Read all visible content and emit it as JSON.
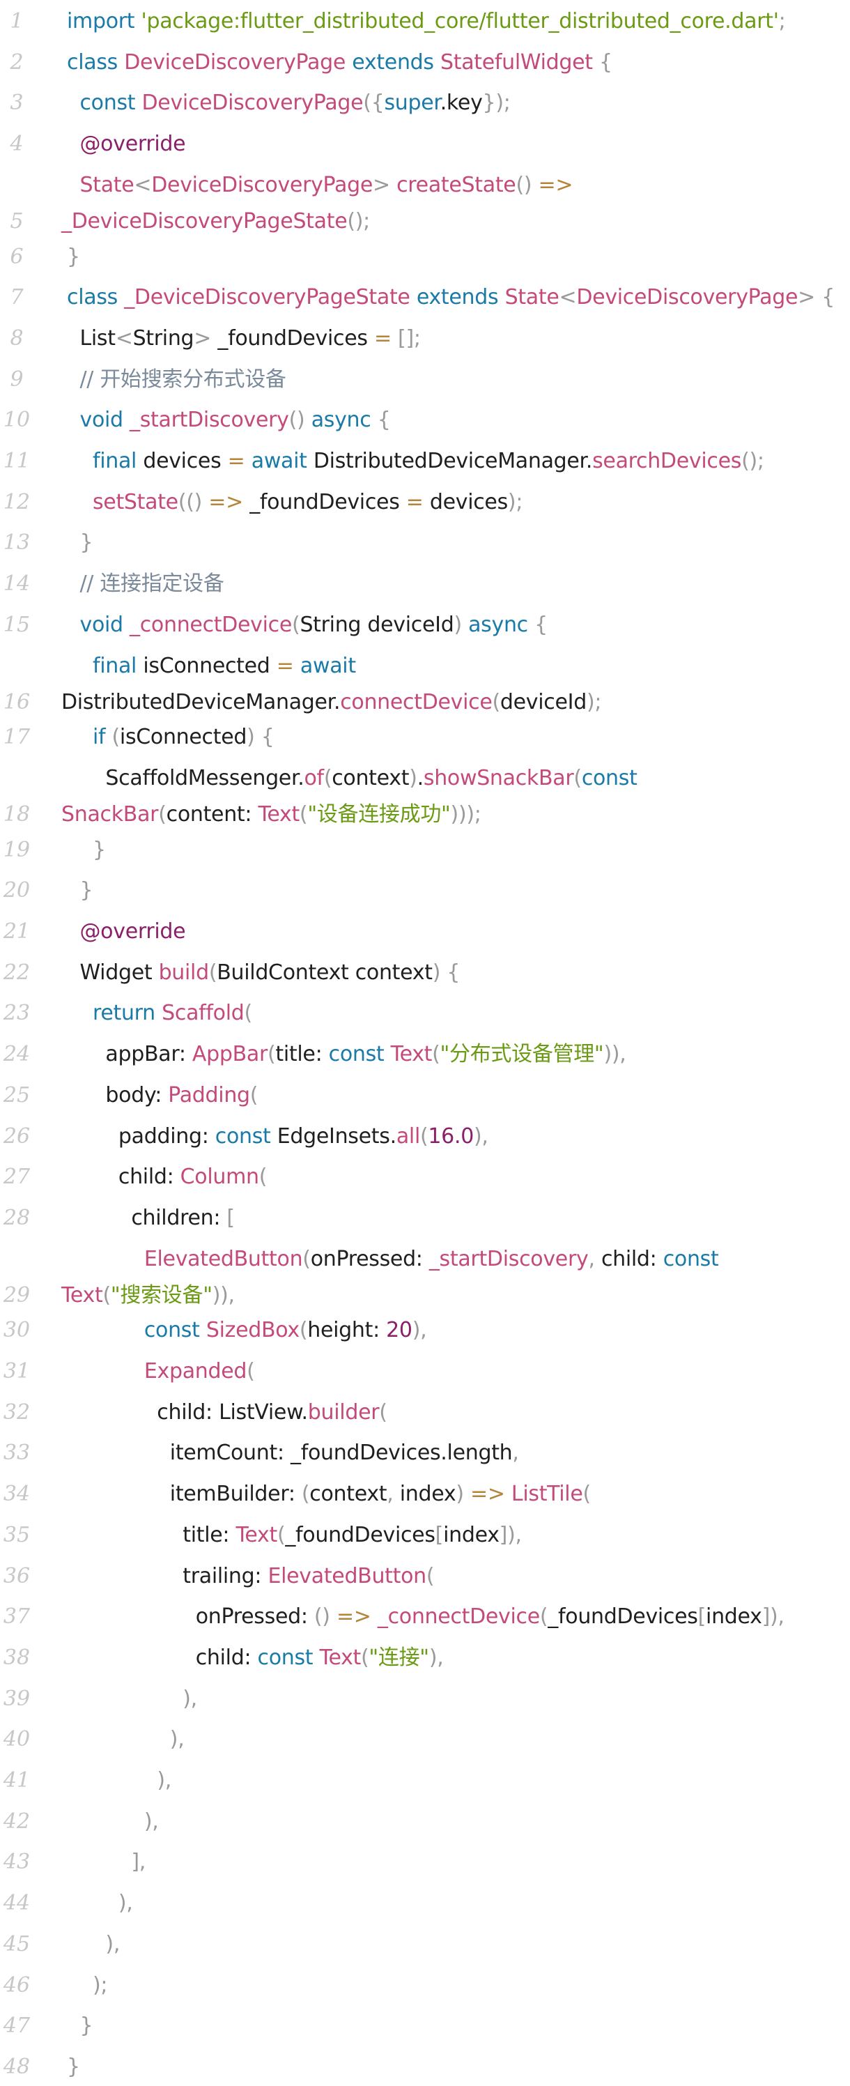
{
  "editor": {
    "lines": [
      {
        "n": "1",
        "text": "import 'package:flutter_distributed_core/flutter_distributed_core.dart';"
      },
      {
        "n": "2",
        "text": "class DeviceDiscoveryPage extends StatefulWidget {"
      },
      {
        "n": "3",
        "text": "  const DeviceDiscoveryPage({super.key});"
      },
      {
        "n": "4",
        "text": "  @override"
      },
      {
        "n": "5",
        "text": "  State<DeviceDiscoveryPage> createState() =>",
        "cont": "_DeviceDiscoveryPageState();"
      },
      {
        "n": "6",
        "text": "}"
      },
      {
        "n": "7",
        "text": "class _DeviceDiscoveryPageState extends State<DeviceDiscoveryPage> {"
      },
      {
        "n": "8",
        "text": "  List<String> _foundDevices = [];"
      },
      {
        "n": "9",
        "text": "  // 开始搜索分布式设备"
      },
      {
        "n": "10",
        "text": "  void _startDiscovery() async {"
      },
      {
        "n": "11",
        "text": "    final devices = await DistributedDeviceManager.searchDevices();"
      },
      {
        "n": "12",
        "text": "    setState(() => _foundDevices = devices);"
      },
      {
        "n": "13",
        "text": "  }"
      },
      {
        "n": "14",
        "text": "  // 连接指定设备"
      },
      {
        "n": "15",
        "text": "  void _connectDevice(String deviceId) async {"
      },
      {
        "n": "16",
        "text": "    final isConnected = await",
        "cont": "DistributedDeviceManager.connectDevice(deviceId);"
      },
      {
        "n": "17",
        "text": "    if (isConnected) {"
      },
      {
        "n": "18",
        "text": "      ScaffoldMessenger.of(context).showSnackBar(const",
        "cont": "SnackBar(content: Text(\"设备连接成功\")));"
      },
      {
        "n": "19",
        "text": "    }"
      },
      {
        "n": "20",
        "text": "  }"
      },
      {
        "n": "21",
        "text": "  @override"
      },
      {
        "n": "22",
        "text": "  Widget build(BuildContext context) {"
      },
      {
        "n": "23",
        "text": "    return Scaffold("
      },
      {
        "n": "24",
        "text": "      appBar: AppBar(title: const Text(\"分布式设备管理\")),"
      },
      {
        "n": "25",
        "text": "      body: Padding("
      },
      {
        "n": "26",
        "text": "        padding: const EdgeInsets.all(16.0),"
      },
      {
        "n": "27",
        "text": "        child: Column("
      },
      {
        "n": "28",
        "text": "          children: ["
      },
      {
        "n": "29",
        "text": "            ElevatedButton(onPressed: _startDiscovery, child: const",
        "cont": "Text(\"搜索设备\")),"
      },
      {
        "n": "30",
        "text": "            const SizedBox(height: 20),"
      },
      {
        "n": "31",
        "text": "            Expanded("
      },
      {
        "n": "32",
        "text": "              child: ListView.builder("
      },
      {
        "n": "33",
        "text": "                itemCount: _foundDevices.length,"
      },
      {
        "n": "34",
        "text": "                itemBuilder: (context, index) => ListTile("
      },
      {
        "n": "35",
        "text": "                  title: Text(_foundDevices[index]),"
      },
      {
        "n": "36",
        "text": "                  trailing: ElevatedButton("
      },
      {
        "n": "37",
        "text": "                    onPressed: () => _connectDevice(_foundDevices[index]),"
      },
      {
        "n": "38",
        "text": "                    child: const Text(\"连接\"),"
      },
      {
        "n": "39",
        "text": "                  ),"
      },
      {
        "n": "40",
        "text": "                ),"
      },
      {
        "n": "41",
        "text": "              ),"
      },
      {
        "n": "42",
        "text": "            ),"
      },
      {
        "n": "43",
        "text": "          ],"
      },
      {
        "n": "44",
        "text": "        ),"
      },
      {
        "n": "45",
        "text": "      ),"
      },
      {
        "n": "46",
        "text": "    );"
      },
      {
        "n": "47",
        "text": "  }"
      },
      {
        "n": "48",
        "text": "}"
      }
    ]
  }
}
